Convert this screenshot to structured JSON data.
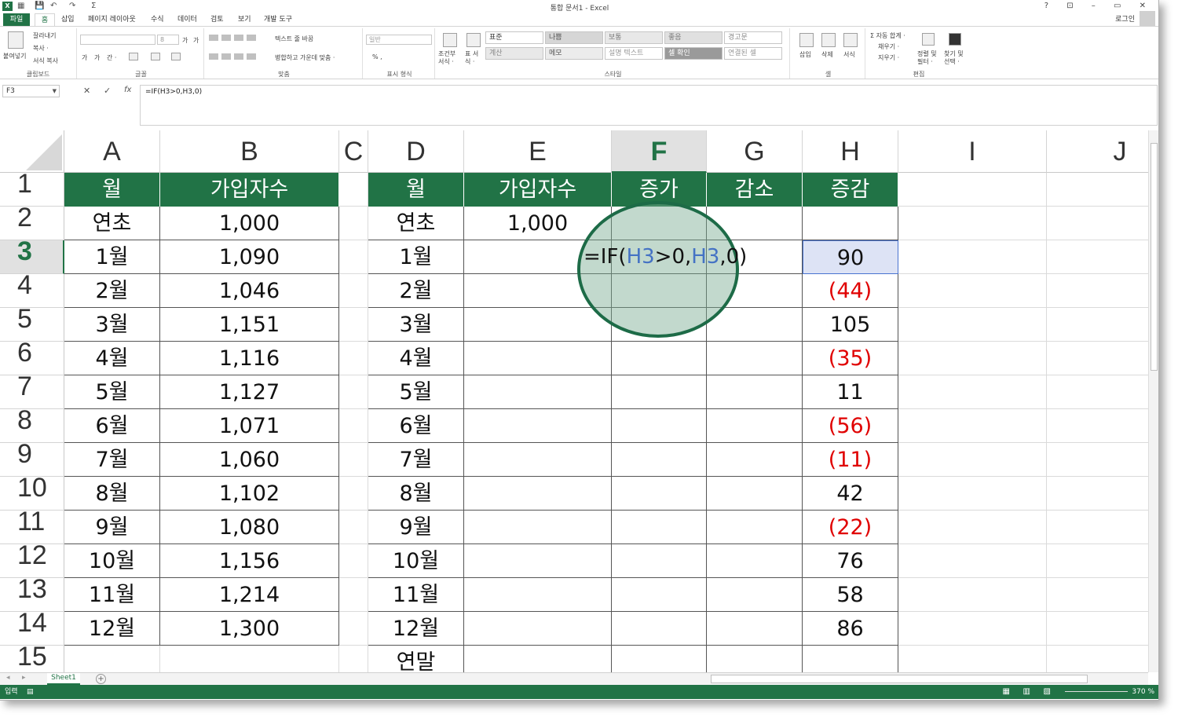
{
  "window": {
    "title": "통합 문서1 - Excel",
    "controls": "?  ⊡  –  ▭  ✕",
    "login": "로그인"
  },
  "quick_access": {
    "save": "💾",
    "undo": "↶",
    "redo": "↷",
    "autosum": "Σ"
  },
  "tabs": [
    "파일",
    "홈",
    "삽입",
    "페이지 레이아웃",
    "수식",
    "데이터",
    "검토",
    "보기",
    "개발 도구"
  ],
  "ribbon": {
    "clipboard": {
      "paste": "붙여넣기",
      "cut": "잘라내기",
      "copy": "복사 ·",
      "format_painter": "서식 복사",
      "label": "클립보드"
    },
    "font": {
      "font_size": "8",
      "label": "글꼴",
      "grow": "가",
      "shrink": "가",
      "bold": "가",
      "italic": "가",
      "underline": "간 ·"
    },
    "alignment": {
      "wrap": "텍스트 줄 바꿈",
      "merge": "병합하고 가운데 맞춤 ·",
      "label": "맞춤"
    },
    "number": {
      "format": "일반",
      "percent": "% ,",
      "label": "표시 형식"
    },
    "styles": {
      "conditional": "조건부 서식 ·",
      "table": "표 서식 ·",
      "cells": [
        {
          "label": "표준",
          "bg": "#ffffff",
          "fg": "#333333"
        },
        {
          "label": "나쁨",
          "bg": "#d6d6d6",
          "fg": "#555555"
        },
        {
          "label": "보통",
          "bg": "#e8e8e8",
          "fg": "#777777"
        },
        {
          "label": "좋음",
          "bg": "#e0e0e0",
          "fg": "#777777"
        },
        {
          "label": "경고문",
          "bg": "#ffffff",
          "fg": "#888888"
        },
        {
          "label": "계산",
          "bg": "#e8e8e8",
          "fg": "#888888"
        },
        {
          "label": "메모",
          "bg": "#ececec",
          "fg": "#555555"
        },
        {
          "label": "설명 텍스트",
          "bg": "#ffffff",
          "fg": "#999999"
        },
        {
          "label": "셀 확인",
          "bg": "#9a9a9a",
          "fg": "#ffffff"
        },
        {
          "label": "연결된 셀",
          "bg": "#ffffff",
          "fg": "#999999"
        }
      ],
      "label": "스타일"
    },
    "cells": {
      "insert": "삽입",
      "delete": "삭제",
      "format": "서식",
      "label": "셀"
    },
    "editing": {
      "autosum": "Σ 자동 합계 ·",
      "fill": "채우기 ·",
      "clear": "지우기 ·",
      "sort": "정렬 및 필터 ·",
      "find": "찾기 및 선택 ·",
      "label": "편집"
    }
  },
  "formula_bar": {
    "name_box": "F3",
    "cancel": "✕",
    "enter": "✓",
    "fx": "fx",
    "formula": "=IF(H3>0,H3,0)"
  },
  "grid": {
    "columns": [
      "A",
      "B",
      "C",
      "D",
      "E",
      "F",
      "G",
      "H",
      "I",
      "J"
    ],
    "selected_column": "F",
    "rows": [
      "1",
      "2",
      "3",
      "4",
      "5",
      "6",
      "7",
      "8",
      "9",
      "10",
      "11",
      "12",
      "13",
      "14",
      "15"
    ],
    "selected_row": "3",
    "left_table": {
      "headers": [
        "월",
        "가입자수"
      ],
      "rows": [
        [
          "연초",
          "1,000"
        ],
        [
          "1월",
          "1,090"
        ],
        [
          "2월",
          "1,046"
        ],
        [
          "3월",
          "1,151"
        ],
        [
          "4월",
          "1,116"
        ],
        [
          "5월",
          "1,127"
        ],
        [
          "6월",
          "1,071"
        ],
        [
          "7월",
          "1,060"
        ],
        [
          "8월",
          "1,102"
        ],
        [
          "9월",
          "1,080"
        ],
        [
          "10월",
          "1,156"
        ],
        [
          "11월",
          "1,214"
        ],
        [
          "12월",
          "1,300"
        ]
      ]
    },
    "right_table": {
      "headers": [
        "월",
        "가입자수",
        "증가",
        "감소",
        "증감"
      ],
      "months": [
        "연초",
        "1월",
        "2월",
        "3월",
        "4월",
        "5월",
        "6월",
        "7월",
        "8월",
        "9월",
        "10월",
        "11월",
        "12월",
        "연말"
      ],
      "subscribers_first": "1,000",
      "change": [
        "",
        "90",
        "(44)",
        "105",
        "(35)",
        "11",
        "(56)",
        "(11)",
        "42",
        "(22)",
        "76",
        "58",
        "86",
        ""
      ],
      "negative_color": "#e00000"
    },
    "accent_color": "#217346"
  },
  "magnifier": {
    "parts": [
      {
        "t": "=IF(",
        "ref": false
      },
      {
        "t": "H3",
        "ref": true
      },
      {
        "t": ">0,",
        "ref": false
      },
      {
        "t": "H3",
        "ref": true
      },
      {
        "t": ",0)",
        "ref": false
      }
    ]
  },
  "sheet_tabs": {
    "active": "Sheet1",
    "add": "+"
  },
  "status": {
    "mode": "입력",
    "zoom": "370 %"
  }
}
